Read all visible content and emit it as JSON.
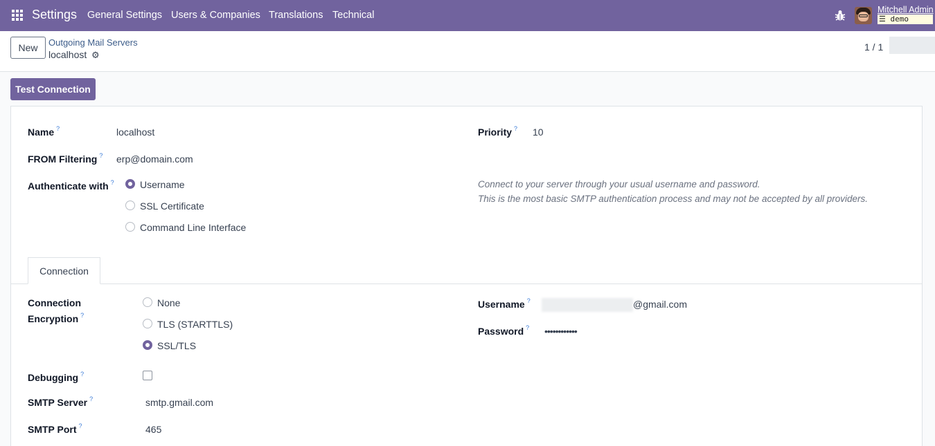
{
  "navbar": {
    "brand": "Settings",
    "menu": [
      "General Settings",
      "Users & Companies",
      "Translations",
      "Technical"
    ],
    "user_name": "Mitchell Admin",
    "db_name": "demo"
  },
  "control_panel": {
    "new_label": "New",
    "breadcrumb_parent": "Outgoing Mail Servers",
    "record_name": "localhost",
    "pager": "1 / 1"
  },
  "form": {
    "test_connection_label": "Test Connection",
    "name": {
      "label": "Name",
      "value": "localhost"
    },
    "from_filtering": {
      "label": "FROM Filtering",
      "value": "erp@domain.com"
    },
    "authenticate_with": {
      "label": "Authenticate with",
      "options": [
        "Username",
        "SSL Certificate",
        "Command Line Interface"
      ],
      "selected": "Username"
    },
    "priority": {
      "label": "Priority",
      "value": "10"
    },
    "auth_hint_line1": "Connect to your server through your usual username and password.",
    "auth_hint_line2": "This is the most basic SMTP authentication process and may not be accepted by all providers.",
    "tabs": [
      "Connection"
    ],
    "connection_encryption": {
      "label_line1": "Connection",
      "label_line2": "Encryption",
      "options": [
        "None",
        "TLS (STARTTLS)",
        "SSL/TLS"
      ],
      "selected": "SSL/TLS"
    },
    "debugging": {
      "label": "Debugging",
      "checked": false
    },
    "smtp_server": {
      "label": "SMTP Server",
      "value": "smtp.gmail.com"
    },
    "smtp_port": {
      "label": "SMTP Port",
      "value": "465"
    },
    "username": {
      "label": "Username",
      "value_suffix": "@gmail.com"
    },
    "password": {
      "label": "Password",
      "value": "••••••••••••"
    },
    "help_marker": "?"
  },
  "colors": {
    "brand": "#71639e",
    "link": "#3d5d8a",
    "help": "#3d7dd8"
  }
}
